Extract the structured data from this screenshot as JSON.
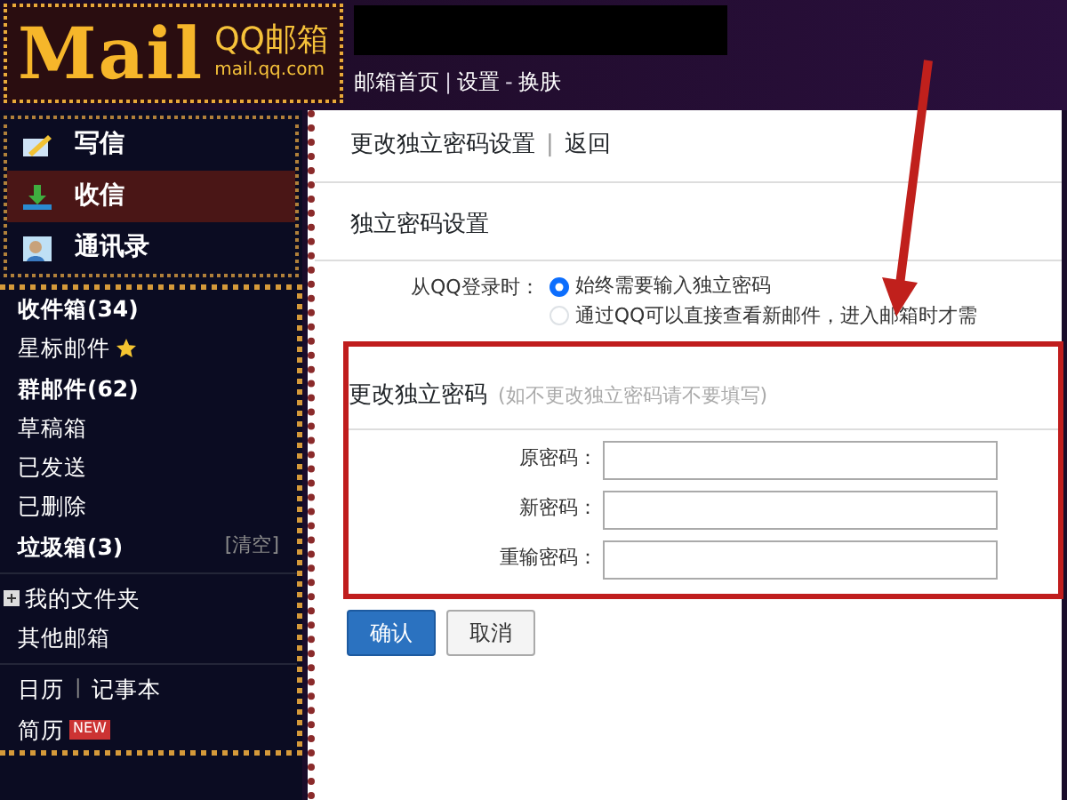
{
  "header": {
    "logo": "Mail",
    "brand": "QQ邮箱",
    "domain": "mail.qq.com",
    "nav": [
      {
        "kind": "link",
        "text": "邮箱首页"
      },
      {
        "kind": "sep",
        "text": "|"
      },
      {
        "kind": "link",
        "text": "设置"
      },
      {
        "kind": "sep",
        "text": "-"
      },
      {
        "kind": "link",
        "text": "换肤"
      }
    ]
  },
  "sidebar": {
    "actions": [
      {
        "label": "写信",
        "selected": false
      },
      {
        "label": "收信",
        "selected": true
      },
      {
        "label": "通讯录",
        "selected": false
      }
    ],
    "folders": [
      {
        "label": "收件箱(34)",
        "bold": true
      },
      {
        "label": "星标邮件",
        "bold": false,
        "star": true
      },
      {
        "label": "群邮件(62)",
        "bold": true
      },
      {
        "label": "草稿箱",
        "bold": false
      },
      {
        "label": "已发送",
        "bold": false
      },
      {
        "label": "已删除",
        "bold": false
      },
      {
        "label": "垃圾箱(3)",
        "bold": true,
        "action": "[清空]"
      }
    ],
    "groups": [
      {
        "label": "我的文件夹",
        "expandable": true
      },
      {
        "label": "其他邮箱",
        "expandable": false
      }
    ],
    "tools": [
      {
        "label": "日历"
      },
      {
        "label": "记事本"
      }
    ],
    "tools_separator": "|",
    "resume": {
      "label": "简历",
      "badge": "NEW"
    }
  },
  "content": {
    "title": "更改独立密码设置",
    "separator": "|",
    "back": "返回",
    "section": "独立密码设置",
    "login_label": "从QQ登录时：",
    "options": [
      {
        "label": "始终需要输入独立密码",
        "selected": true
      },
      {
        "label": "通过QQ可以直接查看新邮件，进入邮箱时才需",
        "selected": false
      }
    ],
    "change": {
      "heading": "更改独立密码",
      "hint": "(如不更改独立密码请不要填写)",
      "fields": [
        {
          "label": "原密码："
        },
        {
          "label": "新密码："
        },
        {
          "label": "重输密码："
        }
      ]
    },
    "buttons": [
      {
        "kind": "primary",
        "label": "确认"
      },
      {
        "kind": "secondary",
        "label": "取消"
      }
    ]
  }
}
